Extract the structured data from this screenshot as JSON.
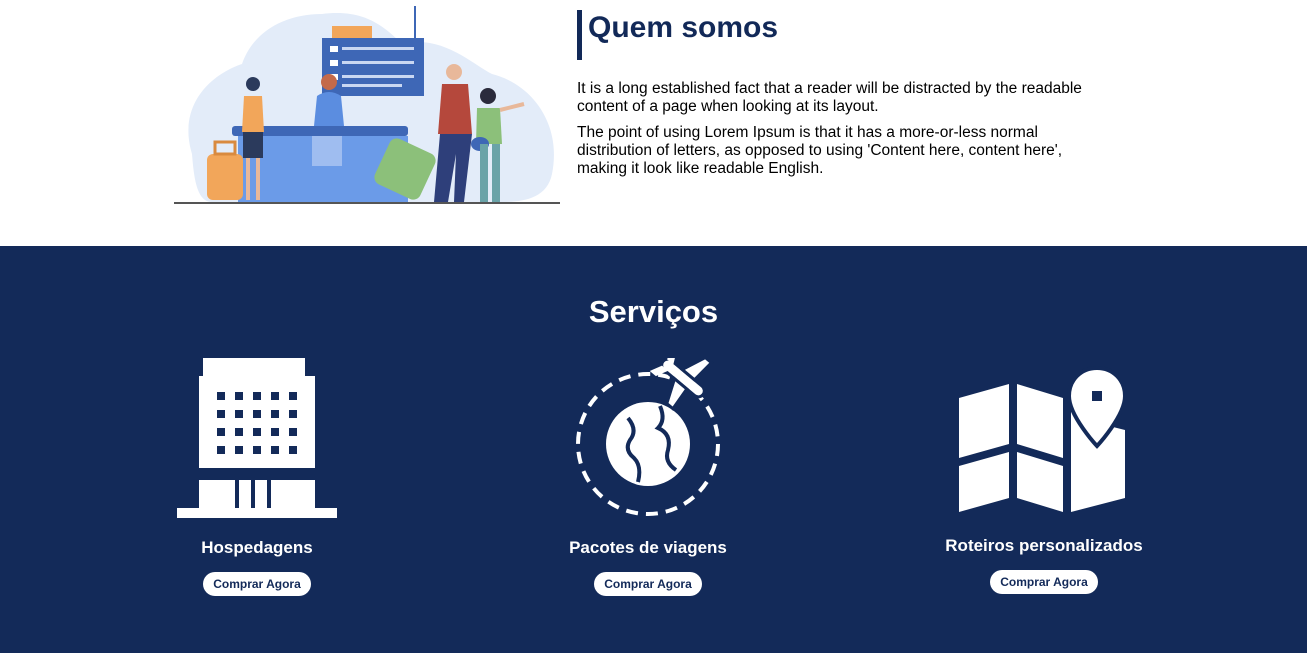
{
  "about": {
    "title": "Quem somos",
    "paragraphs": [
      "It is a long established fact that a reader will be distracted by the readable content of a page when looking at its layout.",
      "The point of using Lorem Ipsum is that it has a more-or-less normal distribution of letters, as opposed to using 'Content here, content here', making it look like readable English."
    ],
    "illustration": "airport-checkin-illustration"
  },
  "services": {
    "title": "Serviços",
    "items": [
      {
        "icon": "hotel-building-icon",
        "title": "Hospedagens",
        "button": "Comprar Agora"
      },
      {
        "icon": "globe-airplane-icon",
        "title": "Pacotes de viagens",
        "button": "Comprar Agora"
      },
      {
        "icon": "map-pin-icon",
        "title": "Roteiros personalizados",
        "button": "Comprar Agora"
      }
    ]
  },
  "colors": {
    "brand_navy": "#132a59",
    "white": "#ffffff",
    "illustration_blue": "#6b9be8",
    "illustration_light": "#e3ecf9"
  }
}
